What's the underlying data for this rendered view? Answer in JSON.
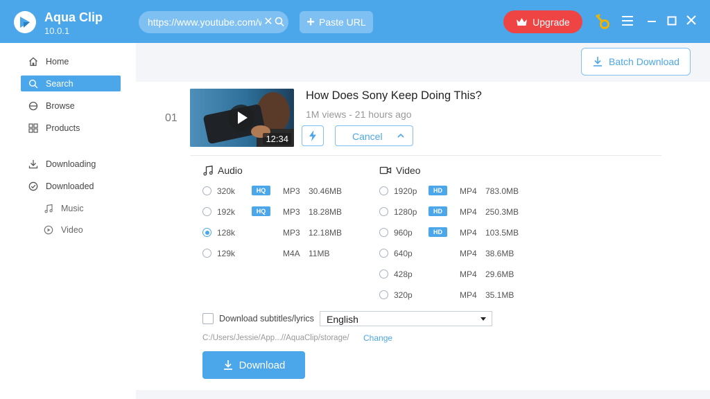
{
  "app": {
    "name": "Aqua Clip",
    "version": "10.0.1"
  },
  "toolbar": {
    "url_value": "https://www.youtube.com/watch",
    "paste_label": "Paste URL",
    "upgrade_label": "Upgrade"
  },
  "colors": {
    "accent": "#4ba6ea",
    "upgrade": "#ef4444",
    "key": "#f0b400"
  },
  "sidebar": {
    "items": [
      {
        "label": "Home",
        "icon": "home-icon"
      },
      {
        "label": "Search",
        "icon": "search-icon",
        "active": true
      },
      {
        "label": "Browse",
        "icon": "browse-icon"
      },
      {
        "label": "Products",
        "icon": "grid-icon"
      },
      {
        "label": "Downloading",
        "icon": "download-icon"
      },
      {
        "label": "Downloaded",
        "icon": "check-circle-icon"
      },
      {
        "label": "Music",
        "icon": "music-note-icon"
      },
      {
        "label": "Video",
        "icon": "play-circle-icon"
      }
    ]
  },
  "main": {
    "batch_label": "Batch Download",
    "item": {
      "index": "01",
      "title": "How Does Sony Keep Doing This?",
      "meta": "1M views - 21 hours ago",
      "duration": "12:34",
      "cancel_label": "Cancel"
    },
    "audio": {
      "heading": "Audio",
      "options": [
        {
          "quality": "320k",
          "badge": "HQ",
          "format": "MP3",
          "size": "30.46MB"
        },
        {
          "quality": "192k",
          "badge": "HQ",
          "format": "MP3",
          "size": "18.28MB"
        },
        {
          "quality": "128k",
          "badge": "",
          "format": "MP3",
          "size": "12.18MB",
          "selected": true
        },
        {
          "quality": "129k",
          "badge": "",
          "format": "M4A",
          "size": "11MB"
        }
      ]
    },
    "video": {
      "heading": "Video",
      "options": [
        {
          "quality": "1920p",
          "badge": "HD",
          "format": "MP4",
          "size": "783.0MB"
        },
        {
          "quality": "1280p",
          "badge": "HD",
          "format": "MP4",
          "size": "250.3MB"
        },
        {
          "quality": "960p",
          "badge": "HD",
          "format": "MP4",
          "size": "103.5MB"
        },
        {
          "quality": "640p",
          "badge": "",
          "format": "MP4",
          "size": "38.6MB"
        },
        {
          "quality": "428p",
          "badge": "",
          "format": "MP4",
          "size": "29.6MB"
        },
        {
          "quality": "320p",
          "badge": "",
          "format": "MP4",
          "size": "35.1MB"
        }
      ]
    },
    "subtitles": {
      "label": "Download subtitles/lyrics",
      "language": "English"
    },
    "save_path": "C:/Users/Jessie/App...//AquaClip/storage/",
    "change_label": "Change",
    "download_label": "Download"
  }
}
